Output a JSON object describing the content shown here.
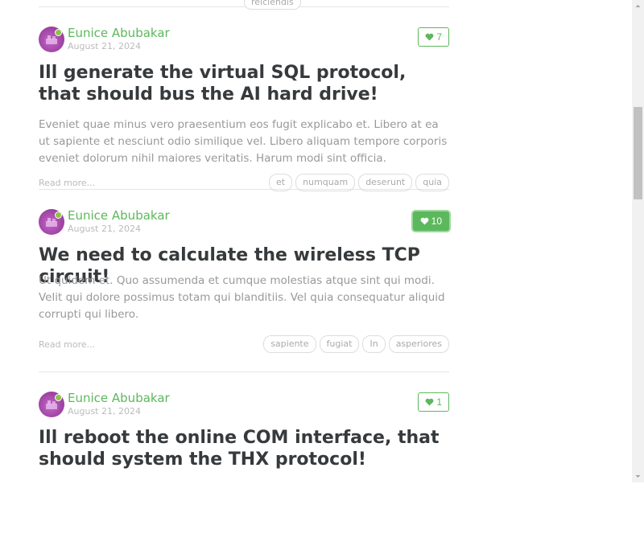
{
  "previous": {
    "tag": "reiciendis"
  },
  "articles": [
    {
      "author": "Eunice Abubakar",
      "date": "August 21, 2024",
      "favorites": "7",
      "favorited": false,
      "title": "Ill generate the virtual SQL protocol, that should bus the AI hard drive!",
      "description": "Eveniet quae minus vero praesentium eos fugit explicabo et. Libero at ea ut sapiente et nesciunt odio similique vel. Libero aliquam tempore corporis eveniet dolorum nihil maiores veritatis. Harum modi sint officia.",
      "read_more": "Read more...",
      "tags": [
        "et",
        "numquam",
        "deserunt",
        "quia"
      ]
    },
    {
      "author": "Eunice Abubakar",
      "date": "August 21, 2024",
      "favorites": "10",
      "favorited": true,
      "title": "We need to calculate the wireless TCP circuit!",
      "description": "Ut quidem et. Quo assumenda et cumque molestias atque sint qui modi. Velit qui dolore possimus totam qui blanditiis. Vel quia consequatur aliquid corrupti qui libero.",
      "read_more": "Read more...",
      "tags": [
        "sapiente",
        "fugiat",
        "In",
        "asperiores"
      ]
    },
    {
      "author": "Eunice Abubakar",
      "date": "August 21, 2024",
      "favorites": "1",
      "favorited": false,
      "title": "Ill reboot the online COM interface, that should system the THX protocol!"
    }
  ],
  "colors": {
    "accent": "#5cb85c",
    "muted": "#999999",
    "title": "#373a3c"
  },
  "icons": {
    "favorite": "heart-icon",
    "avatar_badge": "online-dot"
  }
}
